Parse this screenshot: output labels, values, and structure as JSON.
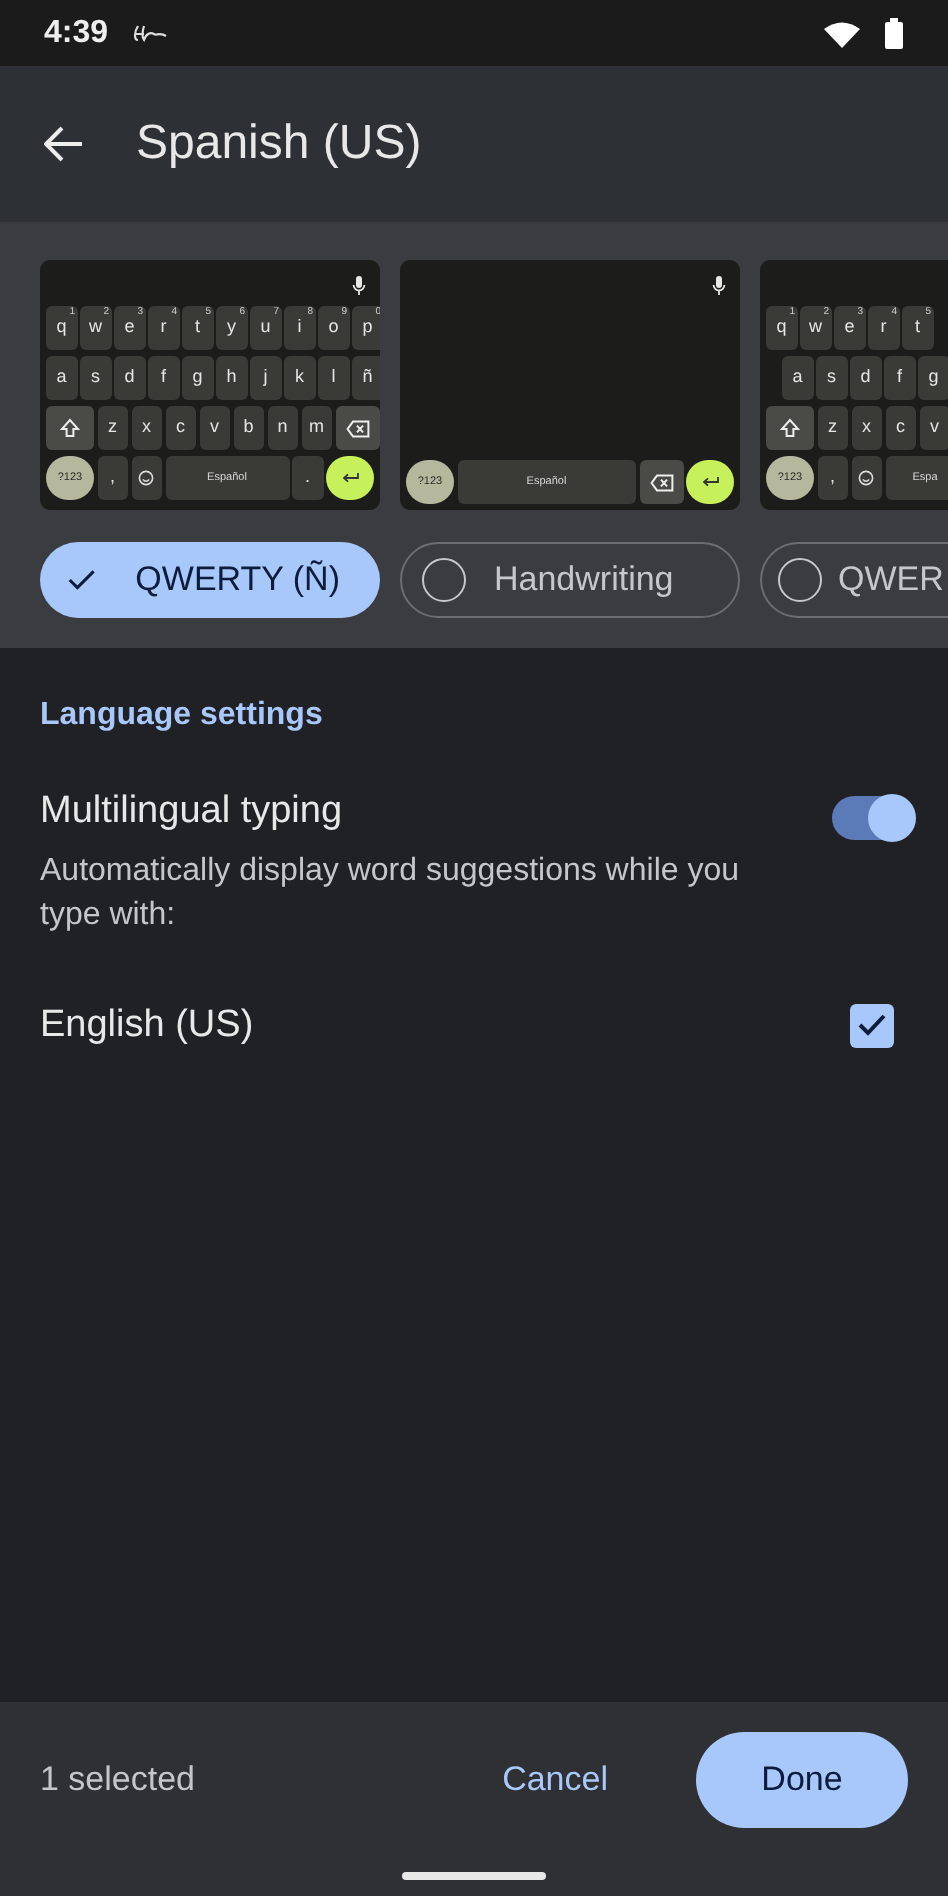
{
  "status_bar": {
    "time": "4:39"
  },
  "app_bar": {
    "title": "Spanish (US)"
  },
  "layouts": [
    {
      "kind": "qwerty",
      "mic": true,
      "rows": [
        {
          "keys": [
            {
              "kind": "letter",
              "label": "q",
              "hint": "1"
            },
            {
              "kind": "letter",
              "label": "w",
              "hint": "2"
            },
            {
              "kind": "letter",
              "label": "e",
              "hint": "3"
            },
            {
              "kind": "letter",
              "label": "r",
              "hint": "4"
            },
            {
              "kind": "letter",
              "label": "t",
              "hint": "5"
            },
            {
              "kind": "letter",
              "label": "y",
              "hint": "6"
            },
            {
              "kind": "letter",
              "label": "u",
              "hint": "7"
            },
            {
              "kind": "letter",
              "label": "i",
              "hint": "8"
            },
            {
              "kind": "letter",
              "label": "o",
              "hint": "9"
            },
            {
              "kind": "letter",
              "label": "p",
              "hint": "0"
            }
          ]
        },
        {
          "keys": [
            {
              "kind": "letter",
              "label": "a"
            },
            {
              "kind": "letter",
              "label": "s"
            },
            {
              "kind": "letter",
              "label": "d"
            },
            {
              "kind": "letter",
              "label": "f"
            },
            {
              "kind": "letter",
              "label": "g"
            },
            {
              "kind": "letter",
              "label": "h"
            },
            {
              "kind": "letter",
              "label": "j"
            },
            {
              "kind": "letter",
              "label": "k"
            },
            {
              "kind": "letter",
              "label": "l"
            },
            {
              "kind": "letter",
              "label": "ñ"
            }
          ]
        },
        {
          "keys": [
            {
              "kind": "shift"
            },
            {
              "kind": "letter",
              "label": "z"
            },
            {
              "kind": "letter",
              "label": "x"
            },
            {
              "kind": "letter",
              "label": "c"
            },
            {
              "kind": "letter",
              "label": "v"
            },
            {
              "kind": "letter",
              "label": "b"
            },
            {
              "kind": "letter",
              "label": "n"
            },
            {
              "kind": "letter",
              "label": "m"
            },
            {
              "kind": "backspace"
            }
          ]
        },
        {
          "keys": [
            {
              "kind": "symbols",
              "label": "?123"
            },
            {
              "kind": "letter",
              "label": ","
            },
            {
              "kind": "emoji"
            },
            {
              "kind": "space",
              "label": "Español"
            },
            {
              "kind": "letter",
              "label": "."
            },
            {
              "kind": "enter"
            }
          ]
        }
      ]
    },
    {
      "kind": "handwriting",
      "mic": true,
      "rows": [
        {
          "keys": [
            {
              "kind": "symbols",
              "label": "?123"
            },
            {
              "kind": "space",
              "label": "Español"
            },
            {
              "kind": "backspace"
            },
            {
              "kind": "enter"
            }
          ]
        }
      ]
    },
    {
      "kind": "partial",
      "mic": false,
      "rows": [
        {
          "keys": [
            {
              "kind": "letter",
              "label": "q",
              "hint": "1"
            },
            {
              "kind": "letter",
              "label": "w",
              "hint": "2"
            },
            {
              "kind": "letter",
              "label": "e",
              "hint": "3"
            },
            {
              "kind": "letter",
              "label": "r",
              "hint": "4"
            },
            {
              "kind": "letter",
              "label": "t",
              "hint": "5"
            }
          ]
        },
        {
          "keys": [
            {
              "kind": "letter",
              "label": "a"
            },
            {
              "kind": "letter",
              "label": "s"
            },
            {
              "kind": "letter",
              "label": "d"
            },
            {
              "kind": "letter",
              "label": "f"
            },
            {
              "kind": "letter",
              "label": "g"
            }
          ]
        },
        {
          "keys": [
            {
              "kind": "shift"
            },
            {
              "kind": "letter",
              "label": "z"
            },
            {
              "kind": "letter",
              "label": "x"
            },
            {
              "kind": "letter",
              "label": "c"
            },
            {
              "kind": "letter",
              "label": "v"
            }
          ]
        },
        {
          "keys": [
            {
              "kind": "symbols",
              "label": "?123"
            },
            {
              "kind": "letter",
              "label": ","
            },
            {
              "kind": "emoji"
            },
            {
              "kind": "space",
              "label": "Espa"
            }
          ]
        }
      ]
    }
  ],
  "layout_options": [
    {
      "label": "QWERTY (Ñ)",
      "selected": true
    },
    {
      "label": "Handwriting",
      "selected": false
    },
    {
      "label": "QWER",
      "selected": false
    }
  ],
  "section": {
    "title": "Language settings"
  },
  "multilingual": {
    "title": "Multilingual typing",
    "description": "Automatically display word suggestions while you type with:",
    "on": true
  },
  "languages": [
    {
      "label": "English (US)",
      "checked": true
    }
  ],
  "bottom_bar": {
    "count": "1 selected",
    "cancel": "Cancel",
    "done": "Done"
  }
}
